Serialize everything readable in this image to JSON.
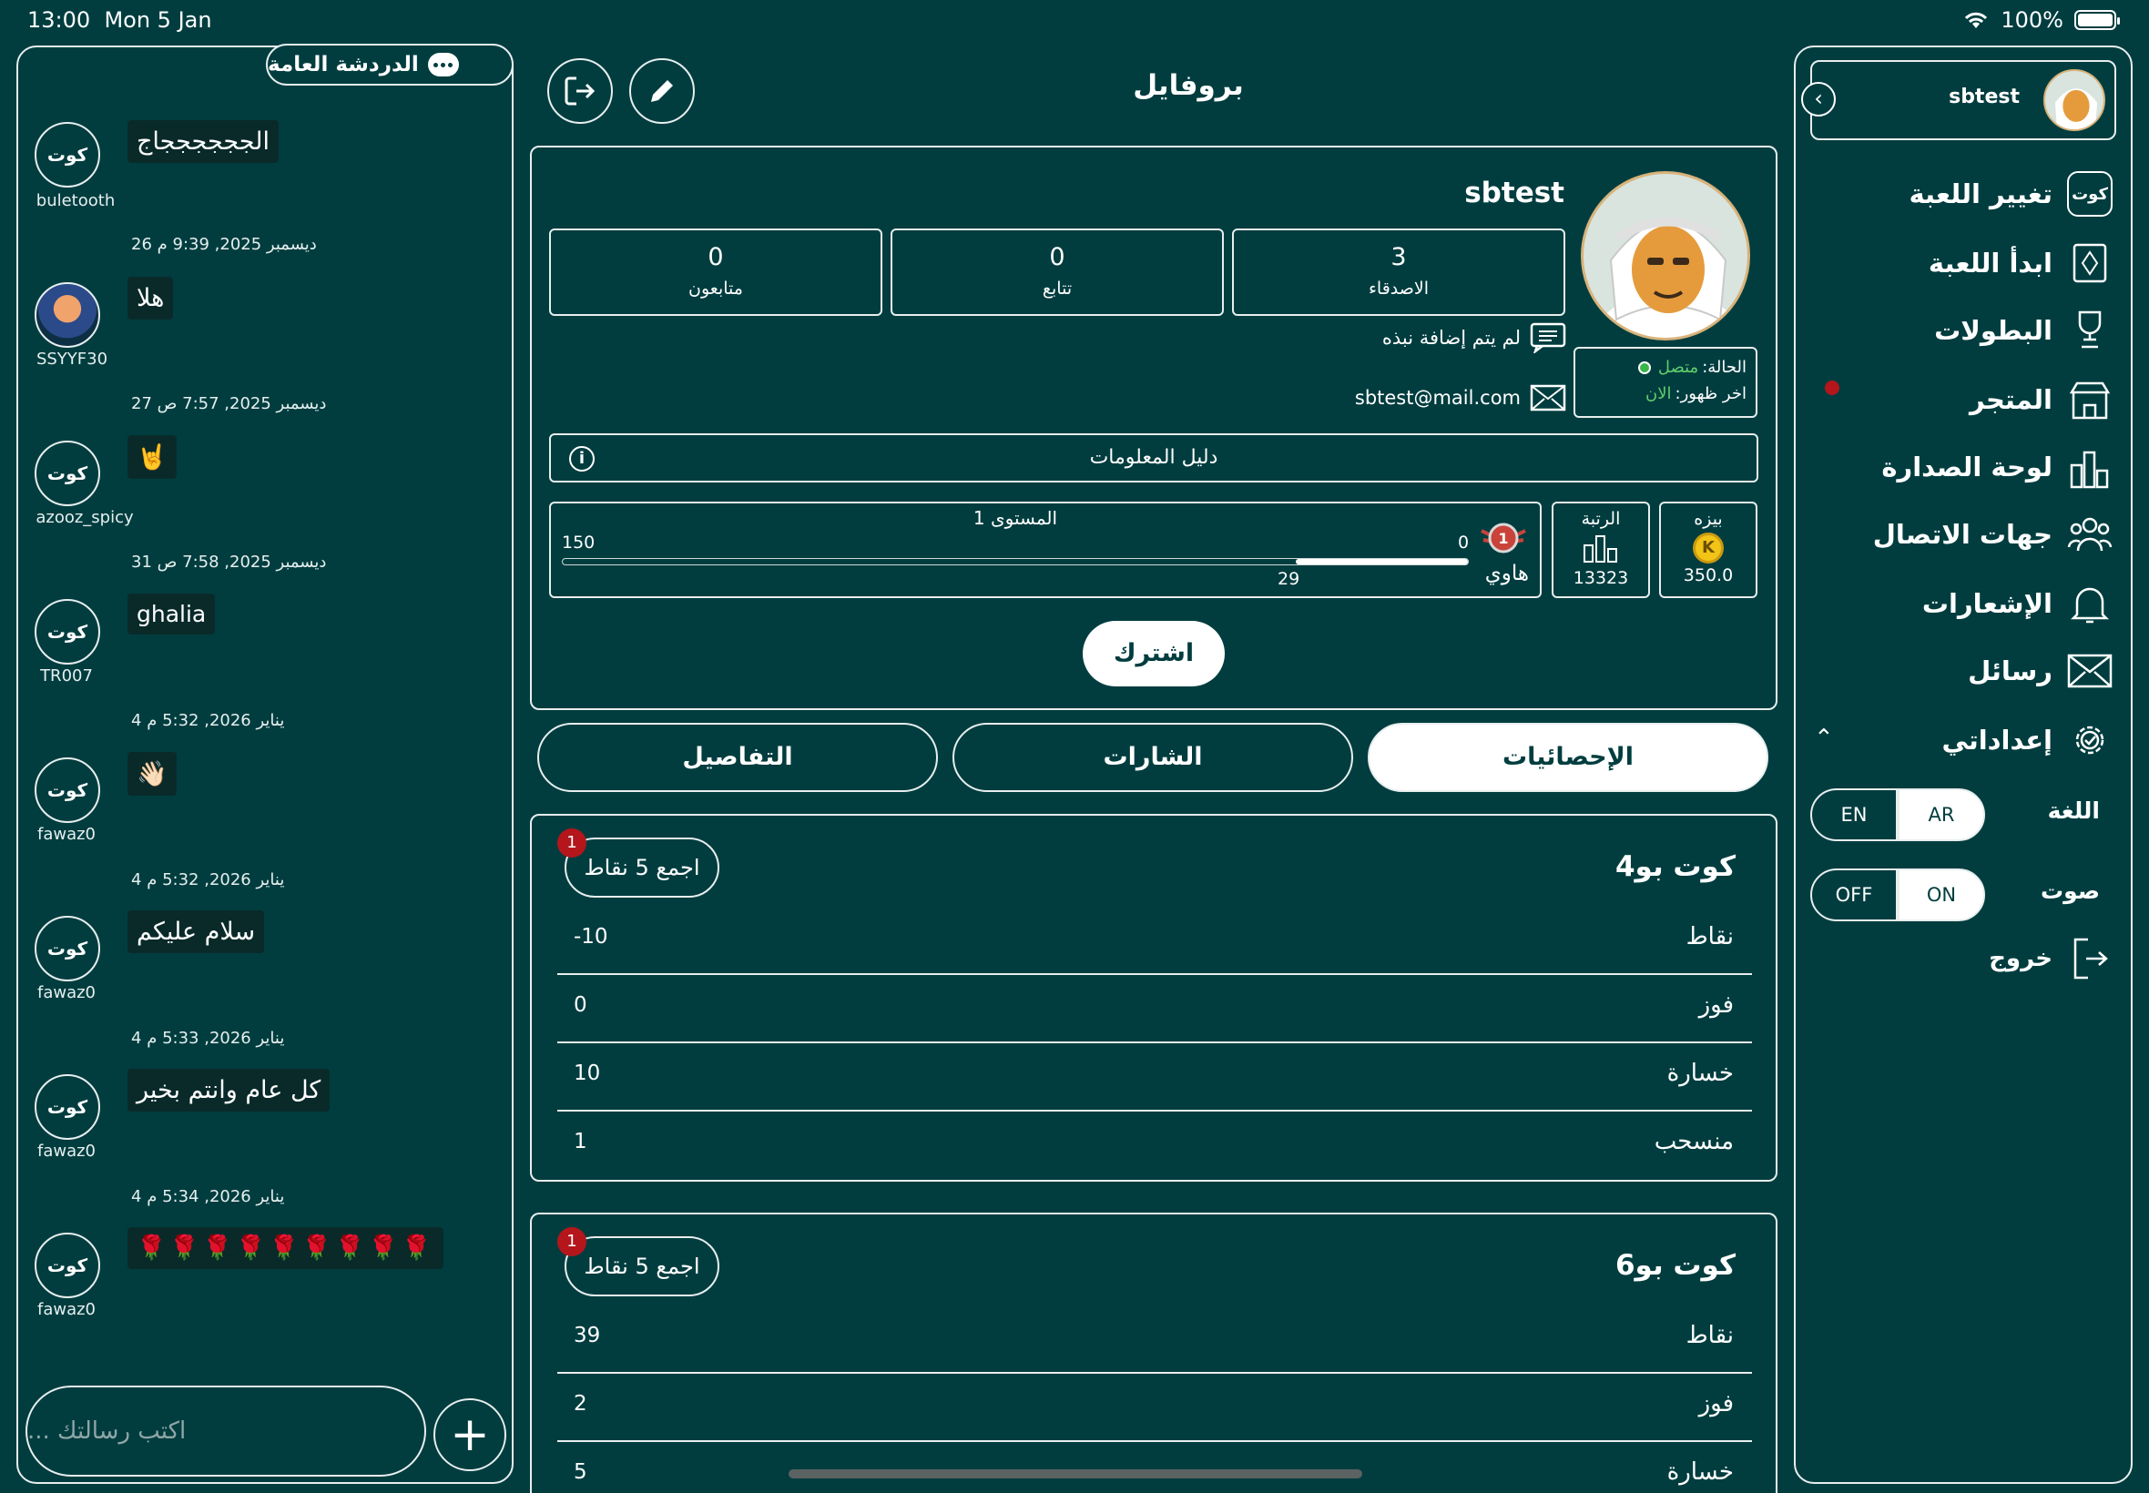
{
  "status_bar": {
    "time": "13:00",
    "date": "Mon 5 Jan",
    "battery": "100%"
  },
  "chat": {
    "title": "الدردشة العامة",
    "input_placeholder": "اكتب رسالتك ...",
    "messages": [
      {
        "user": "buletooth",
        "date": "",
        "text": "الججججججاج",
        "avatar": "kout-logo"
      },
      {
        "user": "SSYYF30",
        "date": "26 ديسمبر 2025, 9:39 م",
        "text": "هلا",
        "avatar": "photo"
      },
      {
        "user": "azooz_spicy",
        "date": "27 ديسمبر 2025, 7:57 ص",
        "text": "🤘",
        "avatar": "kout-logo"
      },
      {
        "user": "TR007",
        "date": "31 ديسمبر 2025, 7:58 ص",
        "text": "ghalia",
        "avatar": "kout-logo"
      },
      {
        "user": "fawaz0",
        "date": "4 يناير 2026, 5:32 م",
        "text": "👋🏻",
        "avatar": "kout-logo"
      },
      {
        "user": "fawaz0",
        "date": "4 يناير 2026, 5:32 م",
        "text": "سلام عليكم",
        "avatar": "kout-logo"
      },
      {
        "user": "fawaz0",
        "date": "4 يناير 2026, 5:33 م",
        "text": "كل عام وانتم بخير",
        "avatar": "kout-logo"
      },
      {
        "user": "fawaz0",
        "date": "4 يناير 2026, 5:34 م",
        "text": "🌹🌹🌹🌹🌹🌹🌹🌹🌹",
        "avatar": "kout-logo"
      }
    ],
    "logo_text": "كوت"
  },
  "profile": {
    "page_title": "بروفايل",
    "username": "sbtest",
    "stats": [
      {
        "label": "الاصدقاء",
        "value": "3"
      },
      {
        "label": "تتابع",
        "value": "0"
      },
      {
        "label": "متابعون",
        "value": "0"
      }
    ],
    "bio": "لم يتم إضافة نبذه",
    "email": "sbtest@mail.com",
    "status_label": "الحالة:",
    "status_value": "متصل",
    "last_seen_label": "اخر ظهور:",
    "last_seen_value": "الان",
    "info_guide": "دليل المعلومات",
    "level": {
      "title": "المستوى 1",
      "rank_name": "هاوي",
      "min": "0",
      "max": "150",
      "current": "29",
      "progress_fraction": 0.19
    },
    "rank": {
      "label": "الرتبة",
      "value": "13323"
    },
    "coins": {
      "label": "بيزه",
      "value": "350.0"
    },
    "subscribe": "اشترك"
  },
  "tabs": [
    {
      "label": "الإحصائيات",
      "active": true
    },
    {
      "label": "الشارات",
      "active": false
    },
    {
      "label": "التفاصيل",
      "active": false
    }
  ],
  "stat_cards": [
    {
      "title": "كوت بو4",
      "collect": "اجمع 5 نقاط",
      "badge": "1",
      "rows": [
        {
          "label": "نقاط",
          "value": "-10"
        },
        {
          "label": "فوز",
          "value": "0"
        },
        {
          "label": "خسارة",
          "value": "10"
        },
        {
          "label": "منسحب",
          "value": "1"
        }
      ]
    },
    {
      "title": "كوت بو6",
      "collect": "اجمع 5 نقاط",
      "badge": "1",
      "rows": [
        {
          "label": "نقاط",
          "value": "39"
        },
        {
          "label": "فوز",
          "value": "2"
        },
        {
          "label": "خسارة",
          "value": "5"
        }
      ]
    }
  ],
  "sidebar": {
    "username": "sbtest",
    "items": [
      {
        "label": "تغيير اللعبة",
        "icon": "kout-logo-icon"
      },
      {
        "label": "ابدأ اللعبة",
        "icon": "cards-icon"
      },
      {
        "label": "البطولات",
        "icon": "trophy-icon"
      },
      {
        "label": "المتجر",
        "icon": "store-icon"
      },
      {
        "label": "لوحة الصدارة",
        "icon": "leaderboard-icon"
      },
      {
        "label": "جهات الاتصال",
        "icon": "contacts-icon"
      },
      {
        "label": "الإشعارات",
        "icon": "bell-icon"
      },
      {
        "label": "رسائل",
        "icon": "envelope-icon"
      },
      {
        "label": "إعداداتي",
        "icon": "gear-icon"
      }
    ],
    "language_label": "اللغة",
    "language_options": [
      "EN",
      "AR"
    ],
    "language_selected": "AR",
    "sound_label": "صوت",
    "sound_options": [
      "OFF",
      "ON"
    ],
    "sound_selected": "ON",
    "logout": "خروج"
  },
  "colors": {
    "background": "#013d3f",
    "accent": "#ffffff",
    "badge": "#b4161b",
    "online": "#39b54a"
  }
}
